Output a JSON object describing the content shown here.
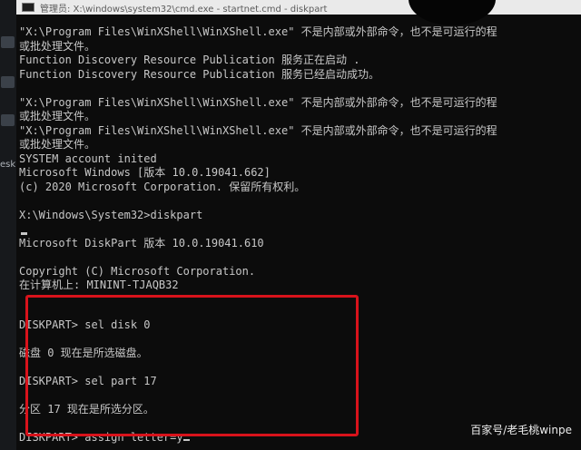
{
  "window": {
    "title": "管理员: X:\\windows\\system32\\cmd.exe - startnet.cmd - diskpart"
  },
  "desktop": {
    "icon_label": "esk"
  },
  "console": {
    "lines": [
      "\"X:\\Program Files\\WinXShell\\WinXShell.exe\" 不是内部或外部命令，也不是可运行的程",
      "或批处理文件。",
      "Function Discovery Resource Publication 服务正在启动 .",
      "Function Discovery Resource Publication 服务已经启动成功。",
      "",
      "\"X:\\Program Files\\WinXShell\\WinXShell.exe\" 不是内部或外部命令，也不是可运行的程",
      "或批处理文件。",
      "\"X:\\Program Files\\WinXShell\\WinXShell.exe\" 不是内部或外部命令，也不是可运行的程",
      "或批处理文件。",
      "SYSTEM account inited",
      "Microsoft Windows [版本 10.0.19041.662]",
      "(c) 2020 Microsoft Corporation. 保留所有权利。",
      "",
      "X:\\Windows\\System32>diskpart",
      "",
      "Microsoft DiskPart 版本 10.0.19041.610",
      "",
      "Copyright (C) Microsoft Corporation.",
      "在计算机上: MININT-TJAQB32"
    ],
    "commands": [
      "DISKPART> sel disk 0",
      "",
      "磁盘 0 现在是所选磁盘。",
      "",
      "DISKPART> sel part 17",
      "",
      "分区 17 现在是所选分区。",
      ""
    ],
    "current_input": "DISKPART> assign letter=y"
  },
  "watermark": "百家号/老毛桃winpe",
  "colors": {
    "console_bg": "#0c0c0c",
    "console_text": "#c7c7c7",
    "highlight_border": "#d8131b"
  }
}
